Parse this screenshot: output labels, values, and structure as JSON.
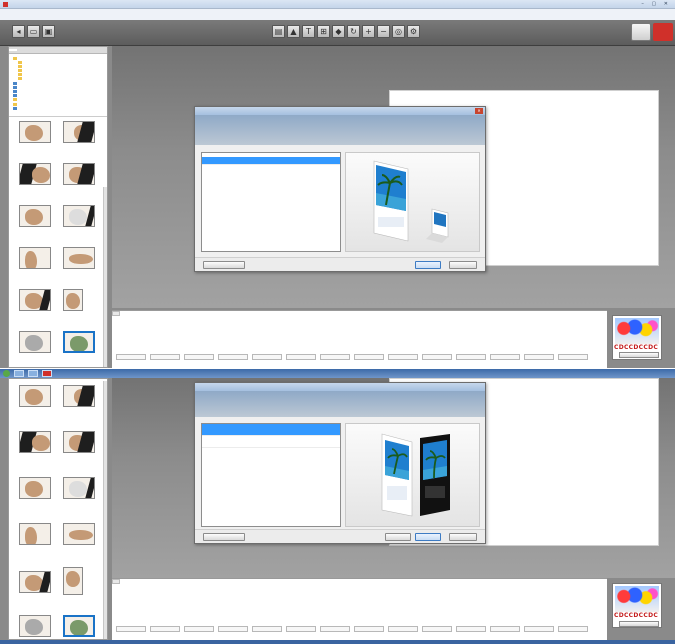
{
  "app": {
    "window_title": "",
    "menu": [],
    "accent": "#d0302a"
  },
  "toolbar": {
    "icons": [
      "undo-icon",
      "view-icon",
      "page-icon",
      "image-icon",
      "text-icon",
      "layout-icon",
      "fill-icon",
      "rotate-icon",
      "zoom-in-icon",
      "zoom-out-icon",
      "preview-icon"
    ]
  },
  "sidebar": {
    "tabs": [],
    "tree_items": [],
    "thumbnail_labels": []
  },
  "workspace": {
    "caption": ""
  },
  "dialog1": {
    "title": "",
    "header_text": "",
    "list_header": "",
    "items": [],
    "buttons": [],
    "link": "",
    "status": ""
  },
  "dialog2": {
    "title": "",
    "header_text": "",
    "items": [],
    "buttons": [],
    "link": "",
    "status": ""
  },
  "filmstrip": {
    "tab": "",
    "caption": "",
    "pages": []
  },
  "brand": {
    "logo_text": "CDCCDCCDC",
    "button": "",
    "colors": [
      "#ff3b3b",
      "#2e62ff",
      "#ffd400",
      "#ff52c8"
    ]
  },
  "taskbar": {
    "clock": ""
  }
}
